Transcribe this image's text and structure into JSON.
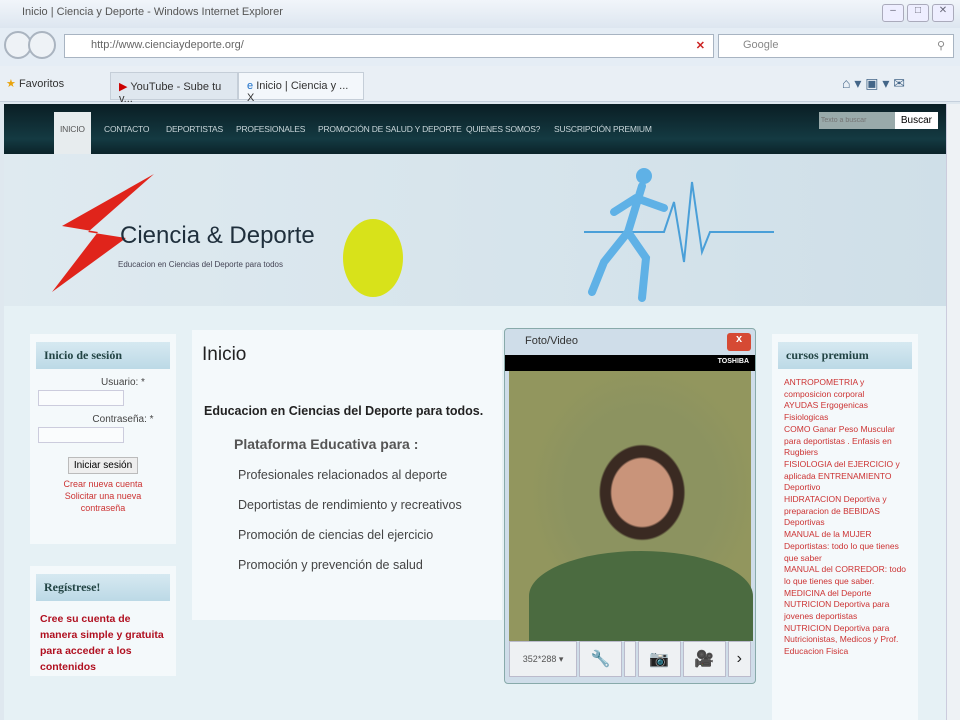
{
  "browser": {
    "title": "Inicio | Ciencia y Deporte - Windows Internet Explorer",
    "url": "http://www.cienciaydeporte.org/",
    "search_placeholder": "Google",
    "favorites": "Favoritos",
    "tabs": [
      {
        "label": "YouTube - Sube tu v..."
      },
      {
        "label": "Inicio | Ciencia y ...",
        "close": "X"
      }
    ]
  },
  "nav": {
    "items": [
      "INICIO",
      "CONTACTO",
      "DEPORTISTAS",
      "PROFESIONALES",
      "PROMOCIÓN DE SALUD Y DEPORTE",
      "QUIENES SOMOS?",
      "SUSCRIPCIÓN PREMIUM"
    ],
    "search_placeholder": "Texto a buscar",
    "search_button": "Buscar"
  },
  "banner": {
    "logo": "Ciencia & Deporte",
    "tagline": "Educacion en Ciencias del Deporte para todos"
  },
  "login": {
    "title": "Inicio de sesión",
    "user_label": "Usuario: *",
    "pass_label": "Contraseña: *",
    "submit": "Iniciar sesión",
    "create": "Crear nueva cuenta",
    "reset": "Solicitar una nueva contraseña"
  },
  "register": {
    "title": "Regístrese!",
    "text": "Cree su cuenta de manera simple y gratuita para acceder a los contenidos"
  },
  "main": {
    "title": "Inicio",
    "lead": "Educacion en Ciencias del Deporte para todos.",
    "sub": "Plataforma Educativa para :",
    "items": [
      "Profesionales relacionados al deporte",
      "Deportistas de rendimiento y recreativos",
      "Promoción de ciencias del ejercicio",
      "Promoción y prevención de salud"
    ]
  },
  "premium": {
    "title": "cursos premium",
    "items": [
      "ANTROPOMETRIA y composicion corporal",
      "AYUDAS Ergogenicas Fisiologicas",
      "COMO Ganar Peso Muscular para deportistas . Enfasis en Rugbiers",
      "FISIOLOGIA del EJERCICIO y aplicada ENTRENAMIENTO Deportivo",
      "HIDRATACION Deportiva y preparacion de BEBIDAS Deportivas",
      "MANUAL de la MUJER Deportistas: todo lo que tienes que saber",
      "MANUAL del CORREDOR: todo lo que tienes que saber.",
      "MEDICINA del Deporte",
      "NUTRICION Deportiva para jovenes deportistas",
      "NUTRICION Deportiva para Nutricionistas, Medicos y Prof. Educacion Fisica"
    ]
  },
  "camera": {
    "title": "Foto/Video",
    "brand": "TOSHIBA",
    "resolution": "352*288",
    "close": "x"
  }
}
